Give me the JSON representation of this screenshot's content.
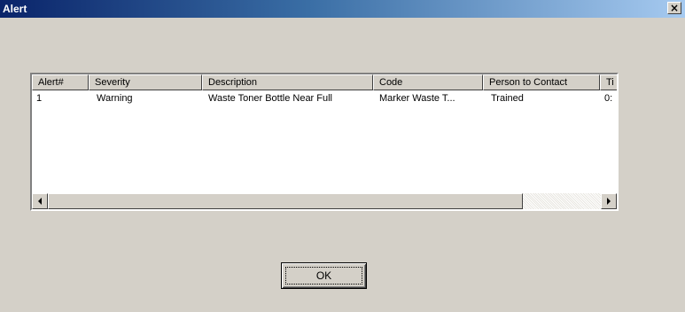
{
  "window": {
    "title": "Alert",
    "close_glyph": "×"
  },
  "table": {
    "columns": [
      "Alert#",
      "Severity",
      "Description",
      "Code",
      "Person to Contact",
      "Ti"
    ],
    "rows": [
      [
        "1",
        "Warning",
        "Waste Toner Bottle Near Full",
        "Marker Waste T...",
        "Trained",
        "0:"
      ]
    ]
  },
  "buttons": {
    "ok_label": "OK"
  },
  "colors": {
    "dialog_bg": "#d4d0c8",
    "title_start": "#0a246a",
    "title_end": "#a6caf0"
  },
  "icons": {
    "scroll_left": "scroll-left-arrow-icon",
    "scroll_right": "scroll-right-arrow-icon"
  }
}
